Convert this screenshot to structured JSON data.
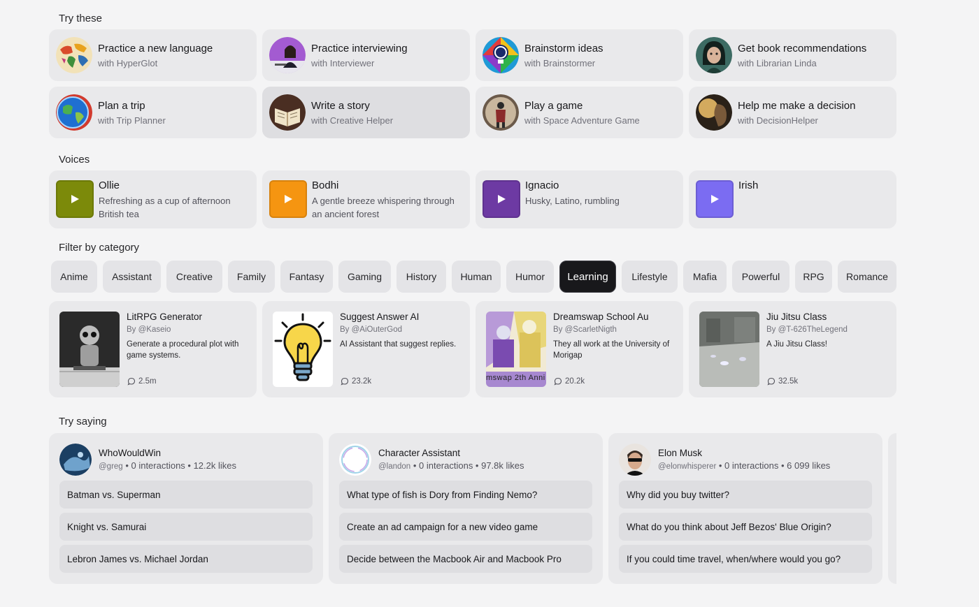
{
  "sections": {
    "try_these": "Try these",
    "voices": "Voices",
    "filter": "Filter by category",
    "try_saying": "Try saying"
  },
  "try_cards": [
    {
      "title": "Practice a new language",
      "sub": "with HyperGlot",
      "icon": "world-map-avatar"
    },
    {
      "title": "Practice interviewing",
      "sub": "with Interviewer",
      "icon": "interviewer-avatar"
    },
    {
      "title": "Brainstorm ideas",
      "sub": "with Brainstormer",
      "icon": "lightbulb-avatar"
    },
    {
      "title": "Get book recommendations",
      "sub": "with Librarian Linda",
      "icon": "librarian-avatar"
    },
    {
      "title": "Plan a trip",
      "sub": "with Trip Planner",
      "icon": "globe-avatar"
    },
    {
      "title": "Write a story",
      "sub": "with Creative Helper",
      "icon": "book-avatar"
    },
    {
      "title": "Play a game",
      "sub": "with Space Adventure Game",
      "icon": "astronaut-avatar"
    },
    {
      "title": "Help me make a decision",
      "sub": "with DecisionHelper",
      "icon": "thinker-avatar"
    }
  ],
  "voices": [
    {
      "name": "Ollie",
      "desc": "Refreshing as a cup of afternoon British tea",
      "color": "#7c8a0a"
    },
    {
      "name": "Bodhi",
      "desc": "A gentle breeze whispering through an ancient forest",
      "color": "#f59511"
    },
    {
      "name": "Ignacio",
      "desc": "Husky, Latino, rumbling",
      "color": "#6d3aa3"
    },
    {
      "name": "Irish",
      "desc": "",
      "color": "#7b6cf2"
    }
  ],
  "chips": [
    "Anime",
    "Assistant",
    "Creative",
    "Family",
    "Fantasy",
    "Gaming",
    "History",
    "Human",
    "Humor",
    "Learning",
    "Lifestyle",
    "Mafia",
    "Powerful",
    "RPG",
    "Romance"
  ],
  "active_chip": "Learning",
  "characters": [
    {
      "title": "LitRPG Generator",
      "by": "By @Kaseio",
      "desc": "Generate a procedural plot with game systems.",
      "count": "2.5m"
    },
    {
      "title": "Suggest Answer AI",
      "by": "By @AiOuterGod",
      "desc": "AI Assistant that suggest replies.",
      "count": "23.2k"
    },
    {
      "title": "Dreamswap School Au",
      "by": "By @ScarletNigth",
      "desc": "They all work at the University of Morigap",
      "count": "20.2k"
    },
    {
      "title": "Jiu Jitsu Class",
      "by": "By @T-626TheLegend",
      "desc": "A Jiu Jitsu Class!",
      "count": "32.5k"
    }
  ],
  "say": [
    {
      "name": "WhoWouldWin",
      "handle": "@greg",
      "stats": " • 0 interactions • 12.2k likes",
      "items": [
        "Batman vs. Superman",
        "Knight vs. Samurai",
        "Lebron James vs. Michael Jordan"
      ]
    },
    {
      "name": "Character Assistant",
      "handle": "@landon",
      "stats": " • 0 interactions • 97.8k likes",
      "items": [
        "What type of fish is Dory from Finding Nemo?",
        "Create an ad campaign for a new video game",
        "Decide between the Macbook Air and Macbook Pro"
      ]
    },
    {
      "name": "Elon Musk",
      "handle": "@elonwhisperer",
      "stats": " • 0 interactions • 6 099 likes",
      "items": [
        "Why did you buy twitter?",
        "What do you think about Jeff Bezos' Blue Origin?",
        "If you could time travel, when/where would you go?"
      ]
    }
  ],
  "dreamswap_caption": "mswap 2th Anni",
  "colors": {
    "background": "#f4f4f5",
    "card": "#e9e9eb",
    "active_chip": "#18181b"
  }
}
